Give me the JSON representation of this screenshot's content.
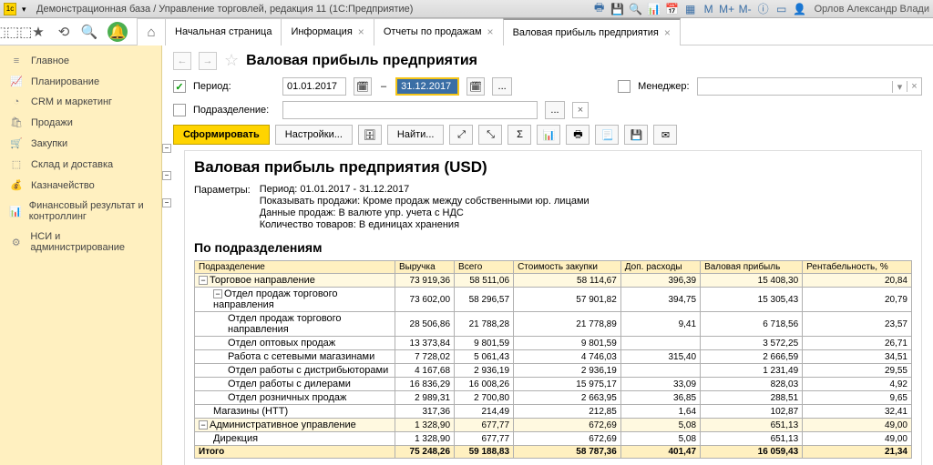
{
  "titlebar": {
    "title": "Демонстрационная база / Управление торговлей, редакция 11   (1С:Предприятие)",
    "user": "Орлов Александр Влади"
  },
  "tabs": {
    "start": "Начальная страница",
    "t1": "Информация",
    "t2": "Отчеты по продажам",
    "t3": "Валовая прибыль предприятия"
  },
  "sidebar": {
    "items": [
      "Главное",
      "Планирование",
      "CRM и маркетинг",
      "Продажи",
      "Закупки",
      "Склад и доставка",
      "Казначейство",
      "Финансовый результат и контроллинг",
      "НСИ и администрирование"
    ]
  },
  "header": {
    "title": "Валовая прибыль предприятия"
  },
  "filters": {
    "period_label": "Период:",
    "date_from": "01.01.2017",
    "date_to": "31.12.2017",
    "dept_label": "Подразделение:",
    "mgr_label": "Менеджер:"
  },
  "buttons": {
    "form": "Сформировать",
    "settings": "Настройки...",
    "find": "Найти..."
  },
  "report": {
    "title": "Валовая прибыль предприятия (USD)",
    "params_label": "Параметры:",
    "params": [
      "Период: 01.01.2017 - 31.12.2017",
      "Показывать продажи: Кроме продаж между собственными юр. лицами",
      "Данные продаж: В валюте упр. учета с НДС",
      "Количество товаров: В единицах хранения"
    ],
    "section": "По подразделениям"
  },
  "table": {
    "headers": [
      "Подразделение",
      "Выручка",
      "Всего",
      "Стоимость закупки",
      "Доп. расходы",
      "Валовая прибыль",
      "Рентабельность, %"
    ],
    "rows": [
      {
        "lvl": 0,
        "tog": "−",
        "name": "Торговое направление",
        "v": [
          "73 919,36",
          "58 511,06",
          "58 114,67",
          "396,39",
          "15 408,30",
          "20,84"
        ]
      },
      {
        "lvl": 1,
        "tog": "−",
        "name": "Отдел продаж торгового направления",
        "v": [
          "73 602,00",
          "58 296,57",
          "57 901,82",
          "394,75",
          "15 305,43",
          "20,79"
        ]
      },
      {
        "lvl": 2,
        "name": "Отдел продаж торгового направления",
        "v": [
          "28 506,86",
          "21 788,28",
          "21 778,89",
          "9,41",
          "6 718,56",
          "23,57"
        ]
      },
      {
        "lvl": 2,
        "name": "Отдел оптовых продаж",
        "v": [
          "13 373,84",
          "9 801,59",
          "9 801,59",
          "",
          "3 572,25",
          "26,71"
        ]
      },
      {
        "lvl": 2,
        "name": "Работа с сетевыми магазинами",
        "v": [
          "7 728,02",
          "5 061,43",
          "4 746,03",
          "315,40",
          "2 666,59",
          "34,51"
        ]
      },
      {
        "lvl": 2,
        "name": "Отдел работы с дистрибьюторами",
        "v": [
          "4 167,68",
          "2 936,19",
          "2 936,19",
          "",
          "1 231,49",
          "29,55"
        ]
      },
      {
        "lvl": 2,
        "name": "Отдел работы с дилерами",
        "v": [
          "16 836,29",
          "16 008,26",
          "15 975,17",
          "33,09",
          "828,03",
          "4,92"
        ]
      },
      {
        "lvl": 2,
        "name": "Отдел розничных продаж",
        "v": [
          "2 989,31",
          "2 700,80",
          "2 663,95",
          "36,85",
          "288,51",
          "9,65"
        ]
      },
      {
        "lvl": 1,
        "name": "Магазины (НТТ)",
        "v": [
          "317,36",
          "214,49",
          "212,85",
          "1,64",
          "102,87",
          "32,41"
        ]
      },
      {
        "lvl": 0,
        "tog": "−",
        "name": "Административное управление",
        "v": [
          "1 328,90",
          "677,77",
          "672,69",
          "5,08",
          "651,13",
          "49,00"
        ]
      },
      {
        "lvl": 1,
        "name": "Дирекция",
        "v": [
          "1 328,90",
          "677,77",
          "672,69",
          "5,08",
          "651,13",
          "49,00"
        ]
      }
    ],
    "total": {
      "name": "Итого",
      "v": [
        "75 248,26",
        "59 188,83",
        "58 787,36",
        "401,47",
        "16 059,43",
        "21,34"
      ]
    }
  }
}
